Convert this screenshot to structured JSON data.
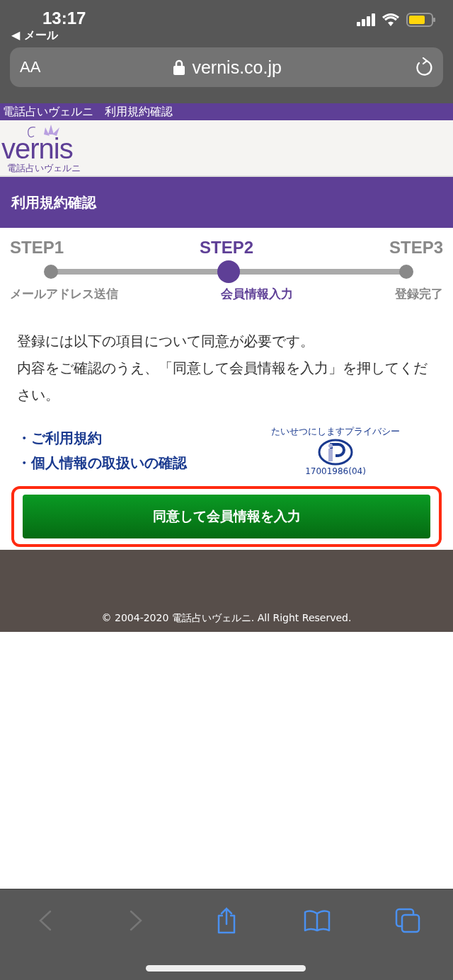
{
  "status_bar": {
    "time": "13:17",
    "back_app": "◀ メール"
  },
  "address_bar": {
    "text_size": "AA",
    "url": "vernis.co.jp"
  },
  "page_title_strip": "電話占いヴェルニ　利用規約確認",
  "logo": {
    "name": "vernis",
    "tagline": "電話占いヴェルニ"
  },
  "header": {
    "title": "利用規約確認"
  },
  "steps": [
    {
      "step": "STEP1",
      "label": "メールアドレス送信",
      "selected": false
    },
    {
      "step": "STEP2",
      "label": "会員情報入力",
      "selected": true
    },
    {
      "step": "STEP3",
      "label": "登録完了",
      "selected": false
    }
  ],
  "intro": [
    "登録には以下の項目について同意が必要です。",
    "内容をご確認のうえ、「同意して会員情報を入力」を押してください。"
  ],
  "links": [
    {
      "bullet": "・",
      "label": "ご利用規約"
    },
    {
      "bullet": "・",
      "label": "個人情報の取扱いの確認"
    }
  ],
  "privacy_mark": {
    "caption": "たいせつにしますプライバシー",
    "number": "17001986(04)"
  },
  "agree_button": {
    "label": "同意して会員情報を入力",
    "highlighted": true
  },
  "footer": {
    "copyright": "© 2004-2020 電話占いヴェルニ. All Right Reserved."
  },
  "toolbar": [
    {
      "kind": "back",
      "disabled": true
    },
    {
      "kind": "forward",
      "disabled": true
    },
    {
      "kind": "share",
      "disabled": false
    },
    {
      "kind": "bookmarks",
      "disabled": false
    },
    {
      "kind": "tabs",
      "disabled": false
    }
  ]
}
